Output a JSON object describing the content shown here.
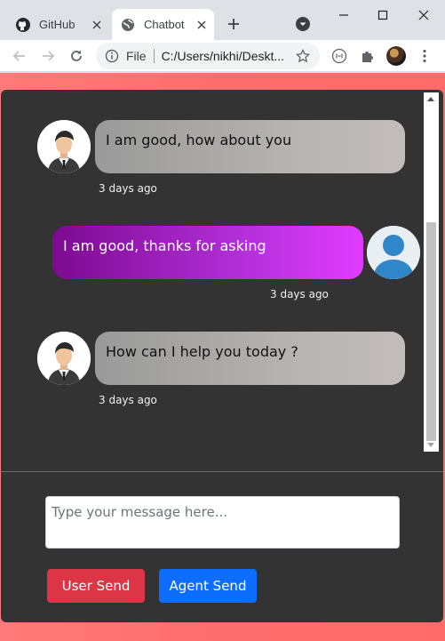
{
  "browser": {
    "tabs": [
      {
        "title": "GitHub",
        "icon": "github-icon",
        "active": false
      },
      {
        "title": "Chatbot",
        "icon": "globe-icon",
        "active": true
      }
    ],
    "address_scheme": "File",
    "address_url": "C:/Users/nikhi/Deskt..."
  },
  "chat": {
    "messages": [
      {
        "sender": "agent",
        "text": "I am good, how about you",
        "time": "3 days ago"
      },
      {
        "sender": "user",
        "text": "I am good, thanks for asking",
        "time": "3 days ago"
      },
      {
        "sender": "agent",
        "text": "How can I help you today ?",
        "time": "3 days ago"
      }
    ]
  },
  "composer": {
    "placeholder": "Type your message here...",
    "value": "",
    "user_send_label": "User Send",
    "agent_send_label": "Agent Send"
  },
  "colors": {
    "page_background": "#ff6e6e",
    "card_background": "#333333",
    "user_send": "#dc3545",
    "agent_send": "#0d6efd",
    "user_bubble": "#b22fd8",
    "agent_bubble": "#b9b6b3"
  }
}
